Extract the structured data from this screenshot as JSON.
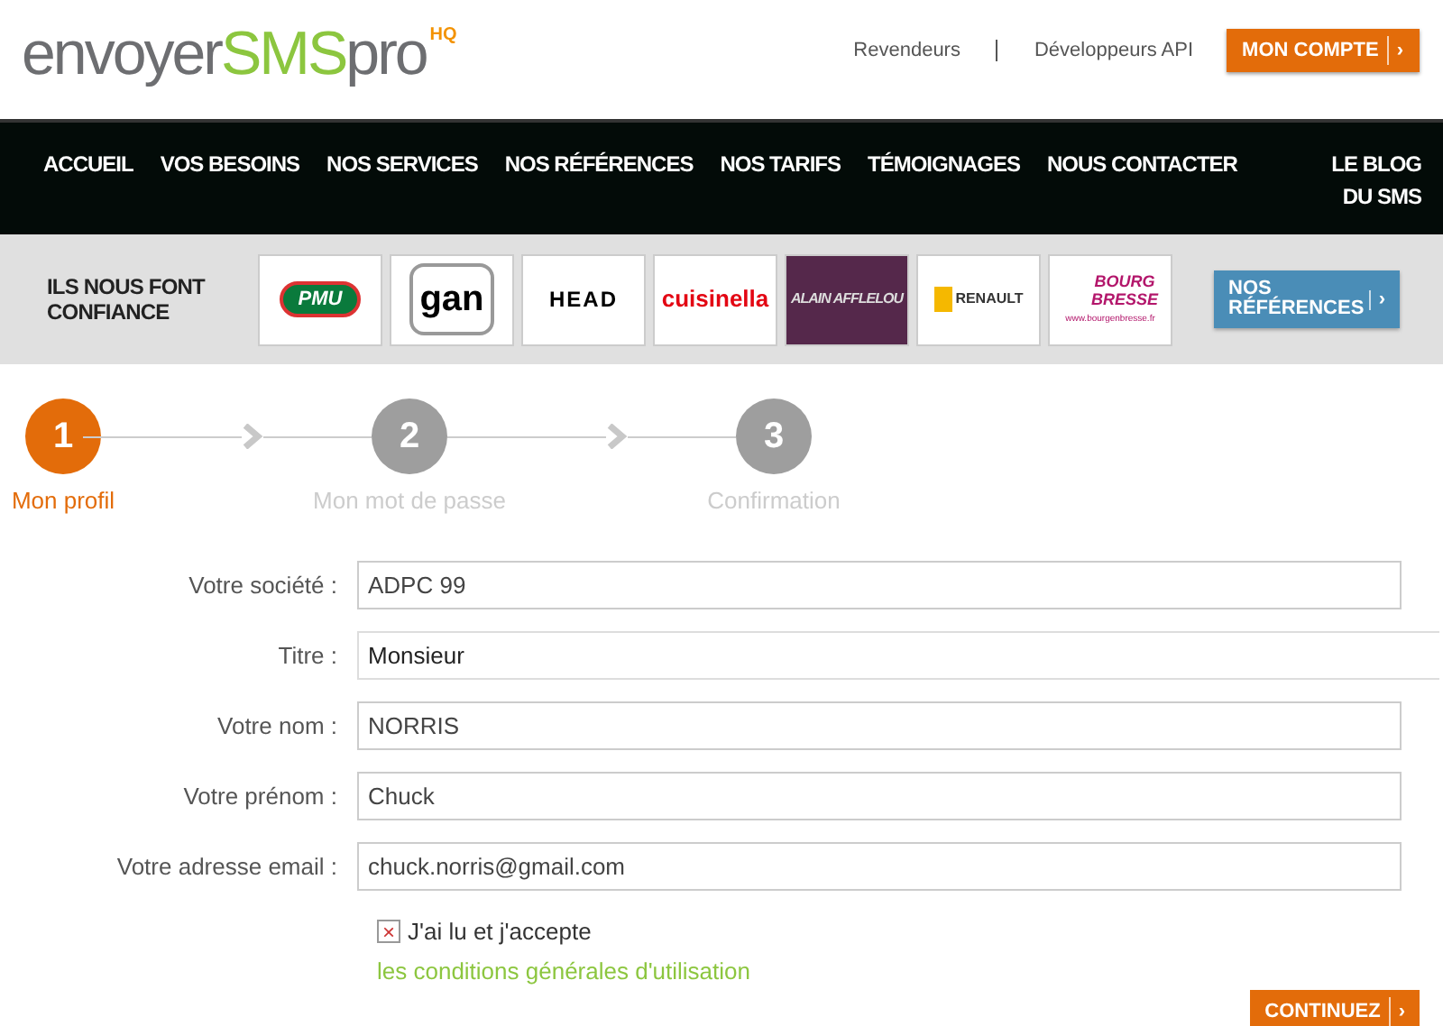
{
  "logo": {
    "parts": [
      {
        "text": "envoyer",
        "kind": "grey"
      },
      {
        "text": "SMS",
        "kind": "green"
      },
      {
        "text": "pro",
        "kind": "grey"
      }
    ],
    "badge": "HQ"
  },
  "top_links": [
    "Revendeurs",
    "Développeurs API"
  ],
  "account_button": {
    "label": "MON COMPTE",
    "arrow": "›"
  },
  "nav": [
    "ACCUEIL",
    "VOS BESOINS",
    "NOS SERVICES",
    "NOS RÉFÉRENCES",
    "NOS TARIFS",
    "TÉMOIGNAGES",
    "NOUS CONTACTER",
    "LE BLOG DU SMS"
  ],
  "trust": {
    "title": "ILS NOUS FONT CONFIANCE",
    "logos": [
      {
        "kind": "pmu",
        "text": "PMU"
      },
      {
        "kind": "gan",
        "text": "gan"
      },
      {
        "kind": "head",
        "text": "HEAD"
      },
      {
        "kind": "cuisinella",
        "text": "cuisinella"
      },
      {
        "kind": "afflelou",
        "text": "ALAIN AFFLELOU"
      },
      {
        "kind": "renault",
        "text": "RENAULT"
      },
      {
        "kind": "bourg",
        "text": "BOURG BRESSE",
        "sub": "www.bourgenbresse.fr"
      }
    ],
    "button": {
      "label": "NOS RÉFÉRENCES",
      "arrow": "›"
    }
  },
  "steps": [
    {
      "number": "1",
      "label": "Mon profil",
      "selected": true
    },
    {
      "number": "2",
      "label": "Mon mot de passe",
      "selected": false
    },
    {
      "number": "3",
      "label": "Confirmation",
      "selected": false
    }
  ],
  "form": {
    "fields": [
      {
        "label": "Votre société :",
        "value": "ADPC 99",
        "kind": "text"
      },
      {
        "label": "Titre :",
        "value": "Monsieur",
        "kind": "select"
      },
      {
        "label": "Votre nom :",
        "value": "NORRIS",
        "kind": "text"
      },
      {
        "label": "Votre prénom :",
        "value": "Chuck",
        "kind": "text"
      },
      {
        "label": "Votre adresse email :",
        "value": "chuck.norris@gmail.com",
        "kind": "text"
      }
    ],
    "terms": {
      "checked": true,
      "mark": "×",
      "label": "J'ai lu et j'accepte",
      "link": "les conditions générales d'utilisation"
    },
    "submit": {
      "label": "CONTINUEZ",
      "arrow": "›"
    }
  }
}
